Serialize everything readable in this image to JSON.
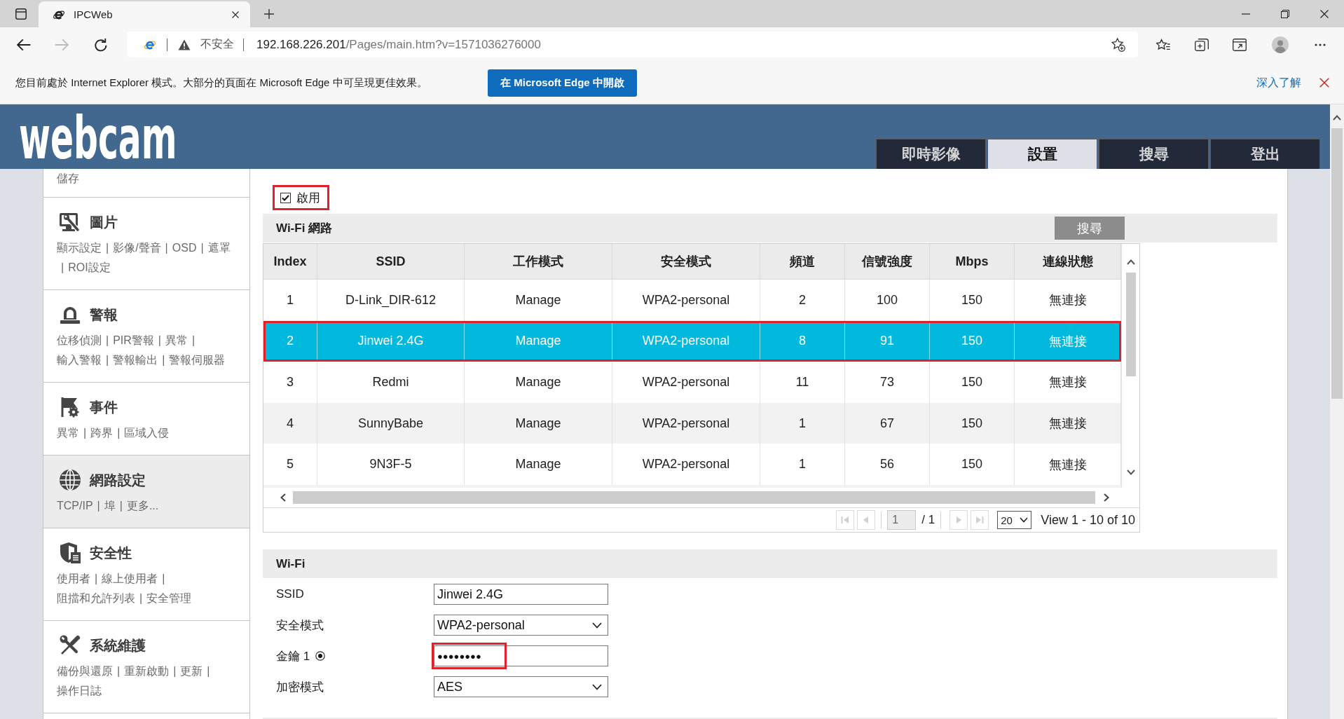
{
  "browser": {
    "tab": {
      "title": "IPCWeb"
    },
    "forward": {
      "disabled": true
    },
    "address": {
      "security": "不安全",
      "host": "192.168.226.201",
      "path": "/Pages/main.htm?v=1571036276000"
    },
    "infobar": {
      "message": "您目前處於 Internet Explorer 模式。大部分的頁面在 Microsoft Edge 中可呈現更佳效果。",
      "button": "在 Microsoft Edge 中開啟",
      "link": "深入了解"
    }
  },
  "header": {
    "logo": "webcam",
    "tabs": [
      {
        "label": "即時影像",
        "selected": false
      },
      {
        "label": "設置",
        "selected": true
      },
      {
        "label": "搜尋",
        "selected": false
      },
      {
        "label": "登出",
        "selected": false
      }
    ]
  },
  "sidebar": {
    "items": [
      {
        "selected": false,
        "lines": [
          [
            {
              "kind": "link",
              "text": "儲存"
            }
          ]
        ]
      },
      {
        "title": "圖片",
        "selected": false,
        "lines": [
          [
            {
              "kind": "link",
              "text": "顯示設定"
            },
            {
              "kind": "separator",
              "text": "|"
            },
            {
              "kind": "link",
              "text": "影像/聲音"
            },
            {
              "kind": "separator",
              "text": "|"
            },
            {
              "kind": "link",
              "text": "OSD"
            },
            {
              "kind": "separator",
              "text": "|"
            },
            {
              "kind": "link",
              "text": "遮罩"
            }
          ],
          [
            {
              "kind": "separator",
              "text": "|"
            },
            {
              "kind": "link",
              "text": "ROI設定"
            }
          ]
        ]
      },
      {
        "title": "警報",
        "selected": false,
        "lines": [
          [
            {
              "kind": "link",
              "text": "位移偵測"
            },
            {
              "kind": "separator",
              "text": "|"
            },
            {
              "kind": "link",
              "text": "PIR警報"
            },
            {
              "kind": "separator",
              "text": "|"
            },
            {
              "kind": "link",
              "text": "異常"
            },
            {
              "kind": "separator",
              "text": "|"
            }
          ],
          [
            {
              "kind": "link",
              "text": "輸入警報"
            },
            {
              "kind": "separator",
              "text": "|"
            },
            {
              "kind": "link",
              "text": "警報輸出"
            },
            {
              "kind": "separator",
              "text": "|"
            },
            {
              "kind": "link",
              "text": "警報伺服器"
            }
          ]
        ]
      },
      {
        "title": "事件",
        "selected": false,
        "lines": [
          [
            {
              "kind": "link",
              "text": "異常"
            },
            {
              "kind": "separator",
              "text": "|"
            },
            {
              "kind": "link",
              "text": "跨界"
            },
            {
              "kind": "separator",
              "text": "|"
            },
            {
              "kind": "link",
              "text": "區域入侵"
            }
          ]
        ]
      },
      {
        "title": "網路設定",
        "selected": true,
        "lines": [
          [
            {
              "kind": "link",
              "text": "TCP/IP"
            },
            {
              "kind": "separator",
              "text": "|"
            },
            {
              "kind": "link",
              "text": "埠"
            },
            {
              "kind": "separator",
              "text": "|"
            },
            {
              "kind": "link",
              "text": "更多..."
            }
          ]
        ]
      },
      {
        "title": "安全性",
        "selected": false,
        "lines": [
          [
            {
              "kind": "link",
              "text": "使用者"
            },
            {
              "kind": "separator",
              "text": "|"
            },
            {
              "kind": "link",
              "text": "線上使用者"
            },
            {
              "kind": "separator",
              "text": "|"
            }
          ],
          [
            {
              "kind": "link",
              "text": "阻擋和允許列表"
            },
            {
              "kind": "separator",
              "text": "|"
            },
            {
              "kind": "link",
              "text": "安全管理"
            }
          ]
        ]
      },
      {
        "title": "系統維護",
        "selected": false,
        "lines": [
          [
            {
              "kind": "link",
              "text": "備份與還原"
            },
            {
              "kind": "separator",
              "text": "|"
            },
            {
              "kind": "link",
              "text": "重新啟動"
            },
            {
              "kind": "separator",
              "text": "|"
            },
            {
              "kind": "link",
              "text": "更新"
            },
            {
              "kind": "separator",
              "text": "|"
            }
          ],
          [
            {
              "kind": "link",
              "text": "操作日誌"
            }
          ]
        ]
      }
    ]
  },
  "enable": {
    "label": "啟用",
    "checked": true,
    "highlighted": true
  },
  "wifi_networks": {
    "title": "Wi-Fi 網路",
    "search_button": "搜尋",
    "table": {
      "columns": [
        "Index",
        "SSID",
        "工作模式",
        "安全模式",
        "頻道",
        "信號強度",
        "Mbps",
        "連線狀態"
      ],
      "rows": [
        {
          "cells": [
            "1",
            "D-Link_DIR-612",
            "Manage",
            "WPA2-personal",
            "2",
            "100",
            "150",
            "無連接"
          ],
          "selected": false,
          "highlighted": false
        },
        {
          "cells": [
            "2",
            "Jinwei 2.4G",
            "Manage",
            "WPA2-personal",
            "8",
            "91",
            "150",
            "無連接"
          ],
          "selected": true,
          "highlighted": true
        },
        {
          "cells": [
            "3",
            "Redmi",
            "Manage",
            "WPA2-personal",
            "11",
            "73",
            "150",
            "無連接"
          ],
          "selected": false,
          "highlighted": false
        },
        {
          "cells": [
            "4",
            "SunnyBabe",
            "Manage",
            "WPA2-personal",
            "1",
            "67",
            "150",
            "無連接"
          ],
          "selected": false,
          "highlighted": false
        },
        {
          "cells": [
            "5",
            "9N3F-5",
            "Manage",
            "WPA2-personal",
            "1",
            "56",
            "150",
            "無連接"
          ],
          "selected": false,
          "highlighted": false
        }
      ]
    },
    "pager": {
      "buttons": [
        {
          "kind": "first",
          "disabled": true
        },
        {
          "kind": "previous",
          "disabled": true
        },
        {
          "kind": "next",
          "disabled": true
        },
        {
          "kind": "last",
          "disabled": true
        }
      ],
      "page": "1",
      "total": "/ 1",
      "page_size": "20",
      "summary": "View 1 - 10 of 10"
    }
  },
  "wifi": {
    "title": "Wi-Fi",
    "fields": [
      {
        "kind": "text",
        "label": "SSID",
        "value": "Jinwei 2.4G",
        "highlighted": false
      },
      {
        "kind": "select",
        "label": "安全模式",
        "value": "WPA2-personal",
        "highlighted": false
      },
      {
        "kind": "password",
        "label": "金鑰 1",
        "radio_selected": true,
        "value": "●●●●●●●●",
        "highlighted": true
      },
      {
        "kind": "select",
        "label": "加密模式",
        "value": "AES",
        "highlighted": false
      }
    ]
  }
}
